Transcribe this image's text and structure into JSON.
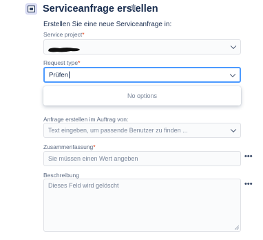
{
  "header": {
    "title": "Serviceanfrage erstellen",
    "intro": "Erstellen Sie eine neue Serviceanfrage in:"
  },
  "service_project": {
    "label": "Service project",
    "required_mark": "*"
  },
  "request_type": {
    "label": "Request type",
    "required_mark": "*",
    "value": "Prüfen",
    "dropdown_message": "No options"
  },
  "on_behalf": {
    "label": "Anfrage erstellen im Auftrag von:",
    "placeholder": "Text eingeben, um passende Benutzer zu finden ..."
  },
  "summary": {
    "label": "Zusammenfassung",
    "required_mark": "*",
    "placeholder": "Sie müssen einen Wert angeben"
  },
  "description": {
    "label": "Beschreibung",
    "placeholder": "Dieses Feld wird gelöscht"
  },
  "more_glyph": "•••",
  "colors": {
    "focus_border": "#4c9aff",
    "required": "#de350b",
    "title": "#172b4d"
  }
}
